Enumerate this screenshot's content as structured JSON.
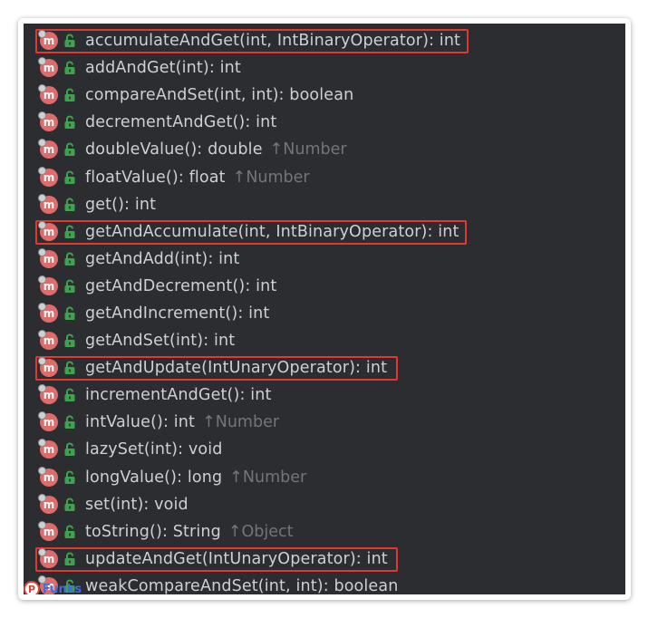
{
  "methods": [
    {
      "signature": "accumulateAndGet(int, IntBinaryOperator): int",
      "inherited": "",
      "highlighted": true
    },
    {
      "signature": "addAndGet(int): int",
      "inherited": "",
      "highlighted": false
    },
    {
      "signature": "compareAndSet(int, int): boolean",
      "inherited": "",
      "highlighted": false
    },
    {
      "signature": "decrementAndGet(): int",
      "inherited": "",
      "highlighted": false
    },
    {
      "signature": "doubleValue(): double",
      "inherited": "↑Number",
      "highlighted": false
    },
    {
      "signature": "floatValue(): float",
      "inherited": "↑Number",
      "highlighted": false
    },
    {
      "signature": "get(): int",
      "inherited": "",
      "highlighted": false
    },
    {
      "signature": "getAndAccumulate(int, IntBinaryOperator): int",
      "inherited": "",
      "highlighted": true
    },
    {
      "signature": "getAndAdd(int): int",
      "inherited": "",
      "highlighted": false
    },
    {
      "signature": "getAndDecrement(): int",
      "inherited": "",
      "highlighted": false
    },
    {
      "signature": "getAndIncrement(): int",
      "inherited": "",
      "highlighted": false
    },
    {
      "signature": "getAndSet(int): int",
      "inherited": "",
      "highlighted": false
    },
    {
      "signature": "getAndUpdate(IntUnaryOperator): int",
      "inherited": "",
      "highlighted": true
    },
    {
      "signature": "incrementAndGet(): int",
      "inherited": "",
      "highlighted": false
    },
    {
      "signature": "intValue(): int",
      "inherited": "↑Number",
      "highlighted": false
    },
    {
      "signature": "lazySet(int): void",
      "inherited": "",
      "highlighted": false
    },
    {
      "signature": "longValue(): long",
      "inherited": "↑Number",
      "highlighted": false
    },
    {
      "signature": "set(int): void",
      "inherited": "",
      "highlighted": false
    },
    {
      "signature": "toString(): String",
      "inherited": "↑Object",
      "highlighted": false
    },
    {
      "signature": "updateAndGet(IntUnaryOperator): int",
      "inherited": "",
      "highlighted": true
    },
    {
      "signature": "weakCompareAndSet(int, int): boolean",
      "inherited": "",
      "highlighted": false
    }
  ],
  "icons": {
    "method": "m",
    "method_icon": "method-icon",
    "visibility_icon": "public-lock-icon"
  },
  "colors": {
    "background": "#2b2d30",
    "highlight": "#e0392f",
    "method_icon": "#e06b6b",
    "lock": "#3fa34d",
    "text": "#cdd0d4",
    "inherited": "#71767c"
  },
  "watermark": {
    "logo_text": "P",
    "text": "Funks"
  }
}
